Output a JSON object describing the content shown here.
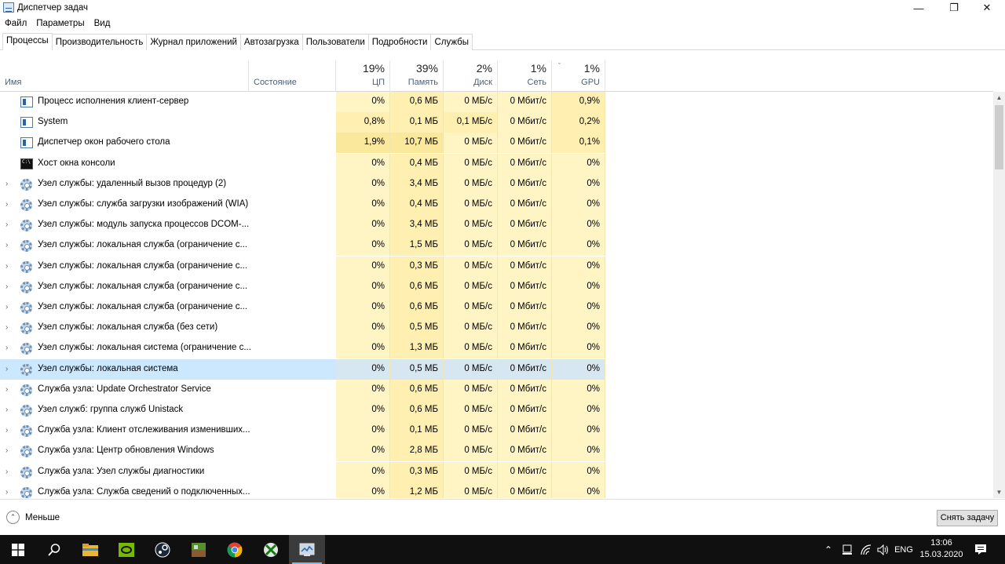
{
  "window": {
    "title": "Диспетчер задач",
    "min_glyph": "—",
    "max_glyph": "❐",
    "close_glyph": "✕"
  },
  "menu": [
    "Файл",
    "Параметры",
    "Вид"
  ],
  "tabs": [
    {
      "label": "Процессы",
      "active": true
    },
    {
      "label": "Производительность"
    },
    {
      "label": "Журнал приложений"
    },
    {
      "label": "Автозагрузка"
    },
    {
      "label": "Пользователи"
    },
    {
      "label": "Подробности"
    },
    {
      "label": "Службы"
    }
  ],
  "columns": {
    "name": "Имя",
    "state": "Состояние",
    "cpu": {
      "pct": "19%",
      "label": "ЦП"
    },
    "mem": {
      "pct": "39%",
      "label": "Память"
    },
    "disk": {
      "pct": "2%",
      "label": "Диск"
    },
    "net": {
      "pct": "1%",
      "label": "Сеть"
    },
    "gpu": {
      "pct": "1%",
      "label": "GPU"
    },
    "sort_glyph": "ˇ"
  },
  "rows": [
    {
      "name": "Процесс исполнения клиент-сервер",
      "icon": "window-icon",
      "expandable": false,
      "cpu": "0%",
      "mem": "0,6 МБ",
      "disk": "0 МБ/с",
      "net": "0 Мбит/с",
      "gpu": "0,9%"
    },
    {
      "name": "System",
      "icon": "window-icon",
      "expandable": false,
      "cpu": "0,8%",
      "mem": "0,1 МБ",
      "disk": "0,1 МБ/с",
      "net": "0 Мбит/с",
      "gpu": "0,2%"
    },
    {
      "name": "Диспетчер окон рабочего стола",
      "icon": "window-icon",
      "expandable": false,
      "cpu": "1,9%",
      "mem": "10,7 МБ",
      "disk": "0 МБ/с",
      "net": "0 Мбит/с",
      "gpu": "0,1%"
    },
    {
      "name": "Хост окна консоли",
      "icon": "console-icon",
      "expandable": false,
      "cpu": "0%",
      "mem": "0,4 МБ",
      "disk": "0 МБ/с",
      "net": "0 Мбит/с",
      "gpu": "0%"
    },
    {
      "name": "Узел службы: удаленный вызов процедур (2)",
      "icon": "gear-icon",
      "expandable": true,
      "cpu": "0%",
      "mem": "3,4 МБ",
      "disk": "0 МБ/с",
      "net": "0 Мбит/с",
      "gpu": "0%"
    },
    {
      "name": "Узел службы: служба загрузки изображений (WIA)",
      "icon": "gear-icon",
      "expandable": true,
      "cpu": "0%",
      "mem": "0,4 МБ",
      "disk": "0 МБ/с",
      "net": "0 Мбит/с",
      "gpu": "0%"
    },
    {
      "name": "Узел службы: модуль запуска процессов DCOM-...",
      "icon": "gear-icon",
      "expandable": true,
      "cpu": "0%",
      "mem": "3,4 МБ",
      "disk": "0 МБ/с",
      "net": "0 Мбит/с",
      "gpu": "0%"
    },
    {
      "name": "Узел службы: локальная служба (ограничение с...",
      "icon": "gear-icon",
      "expandable": true,
      "cpu": "0%",
      "mem": "1,5 МБ",
      "disk": "0 МБ/с",
      "net": "0 Мбит/с",
      "gpu": "0%"
    },
    {
      "name": "Узел службы: локальная служба (ограничение с...",
      "icon": "gear-icon",
      "expandable": true,
      "cpu": "0%",
      "mem": "0,3 МБ",
      "disk": "0 МБ/с",
      "net": "0 Мбит/с",
      "gpu": "0%"
    },
    {
      "name": "Узел службы: локальная служба (ограничение с...",
      "icon": "gear-icon",
      "expandable": true,
      "cpu": "0%",
      "mem": "0,6 МБ",
      "disk": "0 МБ/с",
      "net": "0 Мбит/с",
      "gpu": "0%"
    },
    {
      "name": "Узел службы: локальная служба (ограничение с...",
      "icon": "gear-icon",
      "expandable": true,
      "cpu": "0%",
      "mem": "0,6 МБ",
      "disk": "0 МБ/с",
      "net": "0 Мбит/с",
      "gpu": "0%"
    },
    {
      "name": "Узел службы: локальная служба (без сети)",
      "icon": "gear-icon",
      "expandable": true,
      "cpu": "0%",
      "mem": "0,5 МБ",
      "disk": "0 МБ/с",
      "net": "0 Мбит/с",
      "gpu": "0%"
    },
    {
      "name": "Узел службы: локальная система (ограничение с...",
      "icon": "gear-icon",
      "expandable": true,
      "cpu": "0%",
      "mem": "1,3 МБ",
      "disk": "0 МБ/с",
      "net": "0 Мбит/с",
      "gpu": "0%"
    },
    {
      "name": "Узел службы: локальная система",
      "icon": "gear-icon",
      "expandable": true,
      "selected": true,
      "cpu": "0%",
      "mem": "0,5 МБ",
      "disk": "0 МБ/с",
      "net": "0 Мбит/с",
      "gpu": "0%"
    },
    {
      "name": "Служба узла: Update Orchestrator Service",
      "icon": "gear-icon",
      "expandable": true,
      "cpu": "0%",
      "mem": "0,6 МБ",
      "disk": "0 МБ/с",
      "net": "0 Мбит/с",
      "gpu": "0%"
    },
    {
      "name": "Узел служб: группа служб Unistack",
      "icon": "gear-icon",
      "expandable": true,
      "cpu": "0%",
      "mem": "0,6 МБ",
      "disk": "0 МБ/с",
      "net": "0 Мбит/с",
      "gpu": "0%"
    },
    {
      "name": "Служба узла: Клиент отслеживания изменивших...",
      "icon": "gear-icon",
      "expandable": true,
      "cpu": "0%",
      "mem": "0,1 МБ",
      "disk": "0 МБ/с",
      "net": "0 Мбит/с",
      "gpu": "0%"
    },
    {
      "name": "Служба узла: Центр обновления Windows",
      "icon": "gear-icon",
      "expandable": true,
      "cpu": "0%",
      "mem": "2,8 МБ",
      "disk": "0 МБ/с",
      "net": "0 Мбит/с",
      "gpu": "0%"
    },
    {
      "name": "Служба узла: Узел службы диагностики",
      "icon": "gear-icon",
      "expandable": true,
      "cpu": "0%",
      "mem": "0,3 МБ",
      "disk": "0 МБ/с",
      "net": "0 Мбит/с",
      "gpu": "0%"
    },
    {
      "name": "Служба узла: Служба сведений о подключенных...",
      "icon": "gear-icon",
      "expandable": true,
      "cpu": "0%",
      "mem": "1,2 МБ",
      "disk": "0 МБ/с",
      "net": "0 Мбит/с",
      "gpu": "0%"
    }
  ],
  "footer": {
    "less_label": "Меньше",
    "less_glyph": "⌃",
    "end_task": "Снять задачу"
  },
  "taskbar": {
    "language": "ENG",
    "time": "13:06",
    "date": "15.03.2020",
    "chevron": "⌃",
    "apps": [
      "start-icon",
      "search-icon",
      "file-explorer-icon",
      "nvidia-icon",
      "steam-icon",
      "minecraft-icon",
      "chrome-icon",
      "xbox-icon",
      "task-manager-icon"
    ]
  },
  "colors": {
    "selected_row": "#cce8ff",
    "heat_low": "#fff4c4",
    "heat_high": "#fae99c",
    "taskbar": "#101010"
  }
}
